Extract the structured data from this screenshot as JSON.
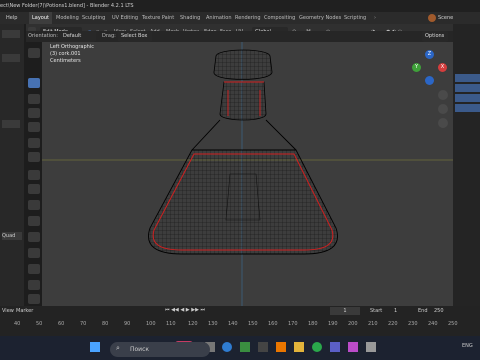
{
  "window": {
    "title": "ect\\New Folder(7)\\Potions1.blend] - Blender 4.2.1 LTS"
  },
  "menu": {
    "help": "Help",
    "tabs": [
      "Layout",
      "Modeling",
      "Sculpting",
      "UV Editing",
      "Texture Paint",
      "Shading",
      "Animation",
      "Rendering",
      "Compositing",
      "Geometry Nodes",
      "Scripting"
    ],
    "active_tab": "Layout",
    "scene_label": "Scene"
  },
  "header": {
    "mode": "Edit Mode",
    "items": [
      "View",
      "Select",
      "Add",
      "Mesh",
      "Vertex",
      "Edge",
      "Face",
      "UV"
    ],
    "transform": "Global",
    "options": "Options"
  },
  "orientation": {
    "label": "Orientation:",
    "value": "Default",
    "drag_label": "Drag:",
    "drag_value": "Select Box"
  },
  "viewport": {
    "info_lines": [
      "Left Orthographic",
      "(3) cork.001",
      "Centimeters"
    ],
    "gizmo": {
      "x": "X",
      "y": "Y",
      "z": "Z"
    }
  },
  "left_panel": {
    "quad_label": "Quad"
  },
  "timeline": {
    "view": "View",
    "marker": "Marker",
    "current_frame": "1",
    "start_label": "Start",
    "start": "1",
    "end_label": "End",
    "end": "250",
    "ruler": [
      "40",
      "50",
      "60",
      "70",
      "80",
      "90",
      "100",
      "110",
      "120",
      "130",
      "140",
      "150",
      "160",
      "170",
      "180",
      "190",
      "200",
      "210",
      "220",
      "230",
      "240",
      "250"
    ],
    "playhead": "1"
  },
  "taskbar": {
    "search_placeholder": "Поиск",
    "lang": "ENG"
  },
  "colors": {
    "accent": "#4772b3",
    "edge_red": "#d11f1f",
    "wire": "#0a0a0a"
  }
}
